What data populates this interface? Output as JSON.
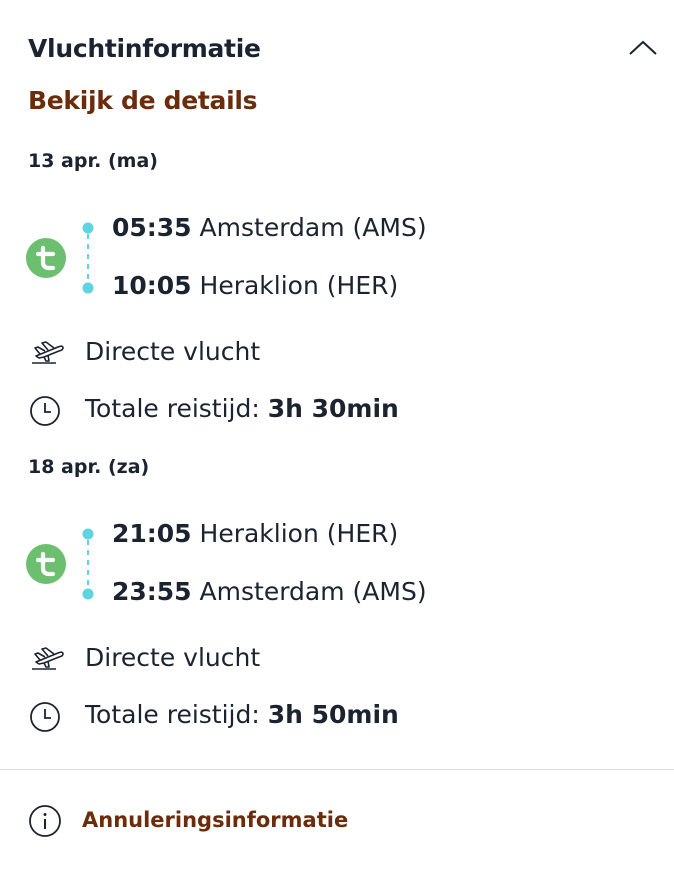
{
  "header": {
    "title": "Vluchtinformatie",
    "collapse_icon": "chevron-up-icon"
  },
  "details_link": "Bekijk de details",
  "colors": {
    "text": "#1c2330",
    "accent_brown": "#6b2c0b",
    "airline_green": "#6bbf6e",
    "timeline_cyan": "#5fd3e0"
  },
  "flights": [
    {
      "date": "13 apr. (ma)",
      "airline_icon": "transavia-logo-icon",
      "departure": {
        "time": "05:35",
        "place": "Amsterdam (AMS)"
      },
      "arrival": {
        "time": "10:05",
        "place": "Heraklion (HER)"
      },
      "flight_type": "Directe vlucht",
      "duration_label": "Totale reistijd:",
      "duration_value": "3h 30min"
    },
    {
      "date": "18 apr. (za)",
      "airline_icon": "transavia-logo-icon",
      "departure": {
        "time": "21:05",
        "place": "Heraklion (HER)"
      },
      "arrival": {
        "time": "23:55",
        "place": "Amsterdam (AMS)"
      },
      "flight_type": "Directe vlucht",
      "duration_label": "Totale reistijd:",
      "duration_value": "3h 50min"
    }
  ],
  "cancellation": {
    "label": "Annuleringsinformatie",
    "icon": "info-icon"
  }
}
